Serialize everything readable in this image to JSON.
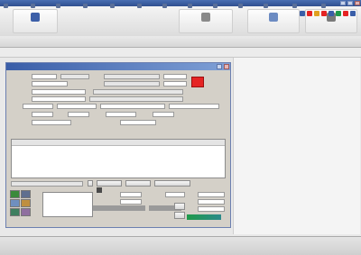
{
  "window": {
    "title": ""
  },
  "ribbon": {
    "buttons": [
      {
        "label": "",
        "icon": "home-icon",
        "color": "#3c5fa8"
      },
      {
        "label": "",
        "icon": "document-icon",
        "color": "#8a8a8a"
      },
      {
        "label": "",
        "icon": "folder-icon",
        "color": "#6c8bc2"
      },
      {
        "label": "",
        "icon": "settings-icon",
        "color": "#7a7a7a"
      }
    ]
  },
  "toolbar": {
    "items": [
      "",
      "",
      "",
      "",
      "",
      "",
      "",
      "",
      "",
      "",
      "",
      "",
      ""
    ]
  },
  "filterbar": {
    "items": [
      "",
      "",
      "",
      "",
      "",
      ""
    ]
  },
  "dialog": {
    "title": "",
    "swatch_color": "#e52424",
    "fields": [],
    "grid": {
      "headers": [
        "",
        "",
        "",
        "",
        "",
        "",
        "",
        "",
        ""
      ],
      "rows": [
        [
          "",
          "",
          "",
          "",
          "",
          "",
          "",
          "",
          ""
        ],
        [
          "",
          "",
          "",
          "",
          "",
          "",
          "",
          "",
          ""
        ],
        [
          "",
          "",
          "",
          "",
          "",
          "",
          "",
          "",
          ""
        ],
        [
          "",
          "",
          "",
          "",
          "",
          "",
          "",
          "",
          ""
        ]
      ]
    },
    "buttons": [
      "",
      "",
      "",
      "",
      ""
    ]
  },
  "statusbar": {
    "cells": [
      "",
      "",
      "",
      "",
      "",
      ""
    ]
  },
  "colors": {
    "accent": "#3a5ea8",
    "red": "#e52424",
    "green": "#1f9a4a",
    "teal": "#2b8a8a"
  }
}
